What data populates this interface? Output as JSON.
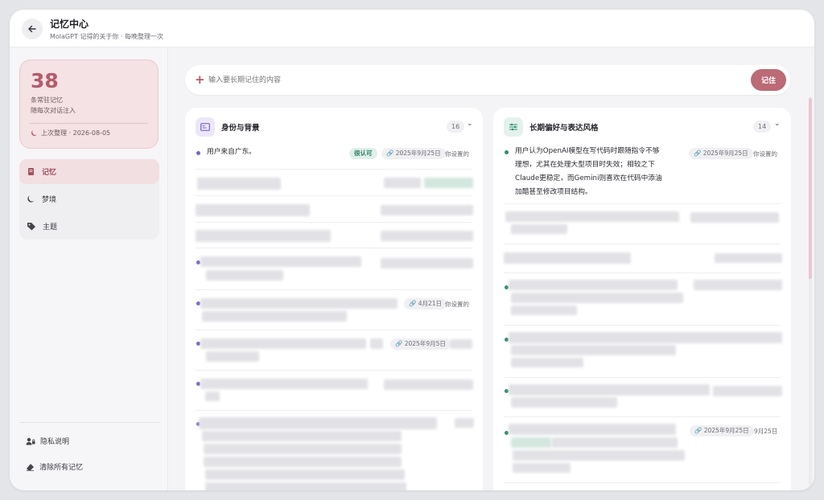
{
  "header": {
    "title": "记忆中心",
    "subtitle": "MolaGPT 记得的关于你 · 每晚整理一次"
  },
  "stats": {
    "count": "38",
    "line1": "条常驻记忆",
    "line2": "随每次对话注入",
    "last_tidy": "上次整理 · 2026-08-05"
  },
  "nav": [
    {
      "label": "记忆",
      "icon": "memory-icon",
      "active": true
    },
    {
      "label": "梦境",
      "icon": "moon-icon",
      "active": false
    },
    {
      "label": "主题",
      "icon": "tag-icon",
      "active": false
    }
  ],
  "footer_links": {
    "privacy": "隐私说明",
    "clear": "清除所有记忆"
  },
  "input": {
    "placeholder": "输入要长期记住的内容",
    "save_label": "记住"
  },
  "panels": [
    {
      "title": "身份与背景",
      "count": "16",
      "icon": "id-card-icon",
      "accent": "#7b63c6",
      "items": [
        {
          "text": "用户来自广东。",
          "tag": "很认可",
          "date": "2025年9月25日",
          "source": "你设置的"
        },
        {
          "date": "4月21日",
          "source": "你设置的"
        },
        {
          "date": "2025年9月5日"
        }
      ]
    },
    {
      "title": "长期偏好与表达风格",
      "count": "14",
      "icon": "sliders-icon",
      "accent": "#2f8c6e",
      "items": [
        {
          "lines": [
            "用户认为OpenAI模型在写代码时跟随指令不够",
            "理想，尤其在处理大型项目时失效；相较之下",
            "Claude更稳定，而Gemini则喜欢在代码中添油",
            "加醋甚至修改项目结构。"
          ],
          "date": "2025年9月25日",
          "source": "你设置的"
        },
        {
          "date": "2025年9月25日",
          "source": "9月25日"
        }
      ]
    }
  ],
  "colors": {
    "accent": "#bb6a76",
    "accent_soft": "#f4e2e5",
    "purple_dot": "#7b63c6",
    "green_dot": "#2f8c6e"
  }
}
